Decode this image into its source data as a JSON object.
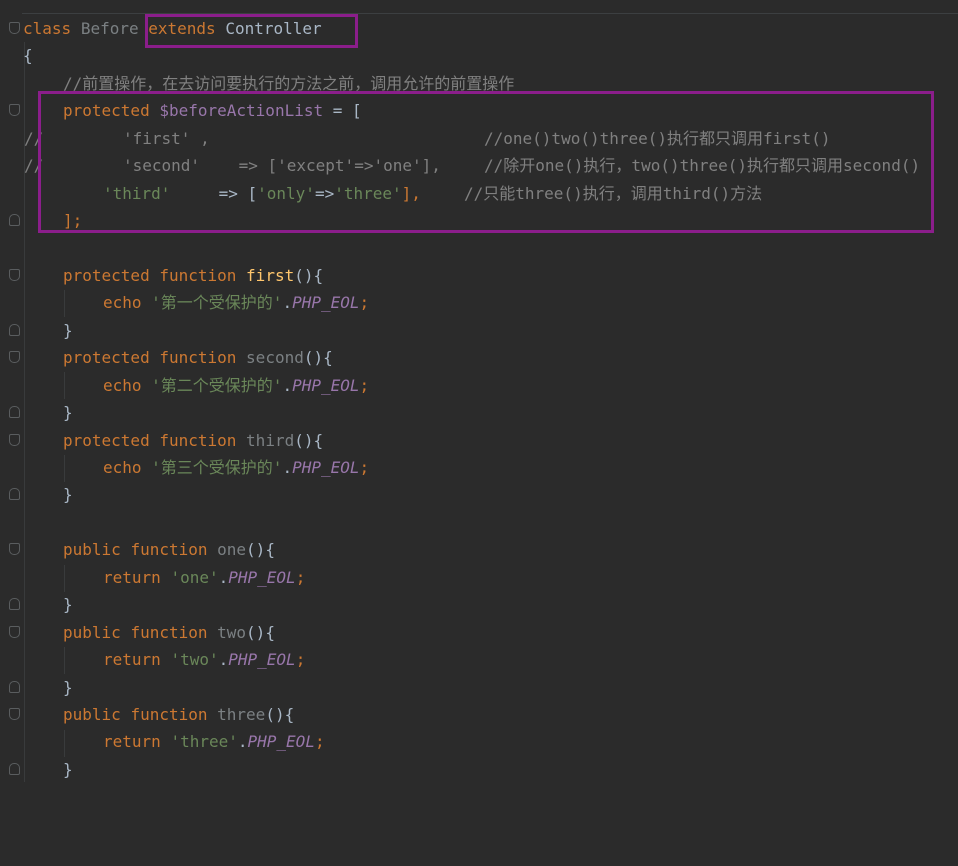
{
  "class_line": {
    "kw_class": "class",
    "name": "Before",
    "kw_extends": "extends",
    "parent": "Controller"
  },
  "brace_open": "{",
  "brace_close": "}",
  "comment_top": "//前置操作，在去访问要执行的方法之前，调用允许的前置操作",
  "before_action": {
    "kw": "protected",
    "var": "$beforeActionList",
    "eq": " = ",
    "bracket": "[",
    "close": "];",
    "commented_lines": [
      {
        "marker": "//",
        "key": "'first'",
        "rest": " ,",
        "comment": "//one()two()three()执行都只调用first()"
      },
      {
        "marker": "//",
        "key": "'second'",
        "arrow": "    => ['except'=>'one'],",
        "comment": "//除开one()执行，two()three()执行都只调用second()"
      }
    ],
    "active_line": {
      "key": "'third'",
      "arrow": "     => [",
      "k2": "'only'",
      "arrow2": "=>",
      "v2": "'three'",
      "close": "],",
      "comment": "//只能three()执行，调用third()方法"
    }
  },
  "methods": [
    {
      "vis": "protected",
      "kw": "function",
      "name": "first",
      "sig": "(){",
      "body_kw": "echo",
      "body_str": "'第一个受保护的'",
      "const": "PHP_EOL",
      "end": "}"
    },
    {
      "vis": "protected",
      "kw": "function",
      "name": "second",
      "sig": "(){",
      "body_kw": "echo",
      "body_str": "'第二个受保护的'",
      "const": "PHP_EOL",
      "end": "}"
    },
    {
      "vis": "protected",
      "kw": "function",
      "name": "third",
      "sig": "(){",
      "body_kw": "echo",
      "body_str": "'第三个受保护的'",
      "const": "PHP_EOL",
      "end": "}"
    },
    {
      "vis": "public",
      "kw": "function",
      "name": "one",
      "sig": "(){",
      "body_kw": "return",
      "body_str": "'one'",
      "const": "PHP_EOL",
      "end": "}"
    },
    {
      "vis": "public",
      "kw": "function",
      "name": "two",
      "sig": "(){",
      "body_kw": "return",
      "body_str": "'two'",
      "const": "PHP_EOL",
      "end": "}"
    },
    {
      "vis": "public",
      "kw": "function",
      "name": "three",
      "sig": "(){",
      "body_kw": "return",
      "body_str": "'three'",
      "const": "PHP_EOL",
      "end": "}"
    }
  ],
  "punct": {
    "dot": ".",
    "semi": ";"
  },
  "colors": {
    "background": "#2b2b2b",
    "keyword": "#cc7832",
    "string": "#6a8759",
    "comment": "#808080",
    "variable": "#9876aa",
    "function": "#ffc66d",
    "text": "#a9b7c6",
    "highlight": "#8b1e8b"
  }
}
